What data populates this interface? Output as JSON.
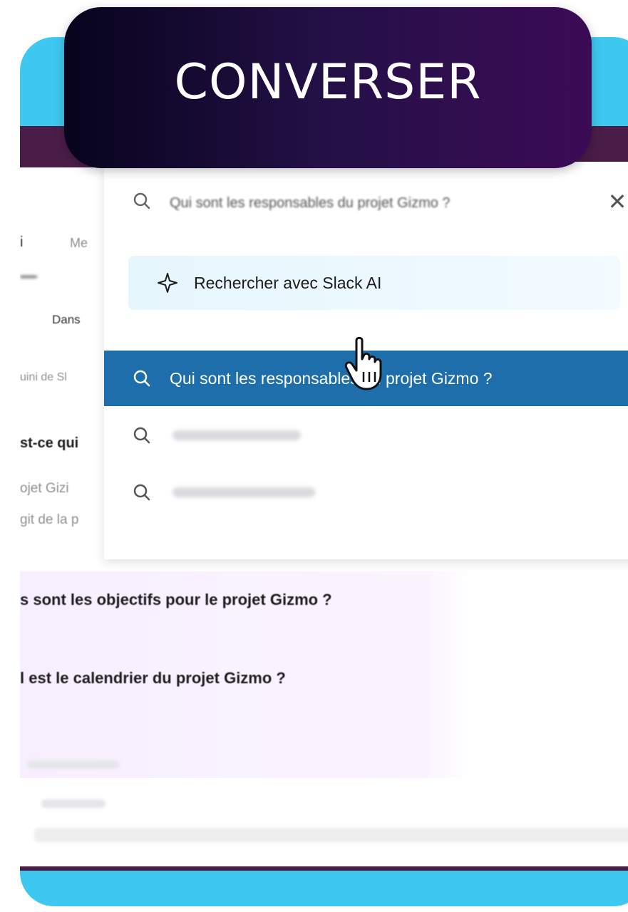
{
  "banner": {
    "title": "CONVERSER"
  },
  "background": {
    "nav_item_1": "i",
    "nav_item_2": "Me",
    "filter_label": "Dans",
    "snippet_1": "uini de Sl",
    "heading_1": "st-ce qui",
    "line_1": "ojet Gizi",
    "line_2": "git de la p",
    "question_2": "s sont les objectifs pour le projet Gizmo ?",
    "question_3": "l est le calendrier du projet Gizmo ?"
  },
  "search": {
    "query": "Qui sont les responsables du projet Gizmo ?",
    "ai_option_label": "Rechercher avec Slack AI",
    "results": [
      {
        "label": "Qui sont les responsables du projet Gizmo ?",
        "selected": true
      }
    ]
  },
  "icons": {
    "search": "search-icon",
    "close": "close-icon",
    "sparkle": "sparkle-icon",
    "pointer": "hand-pointer-icon"
  },
  "colors": {
    "frame": "#3fc8ef",
    "banner_start": "#07041d",
    "banner_end": "#3b0b55",
    "selected_row": "#1d6eaa",
    "app_bar": "#4a1d49"
  }
}
